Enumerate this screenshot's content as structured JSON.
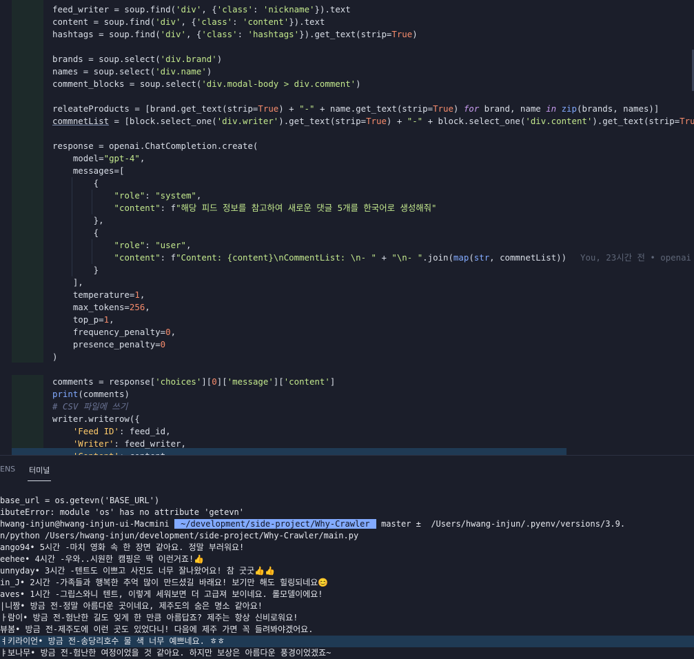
{
  "editor": {
    "blame_text": "You, 23시간 전 • openai",
    "lines": [
      {
        "t": 5,
        "text": "feed_writer = soup.find('div', {'class': 'nickname'}).text"
      },
      {
        "t": 23,
        "text": "content = soup.find('div', {'class': 'content'}).text"
      },
      {
        "t": 41,
        "text": "hashtags = soup.find('div', {'class': 'hashtags'}).get_text(strip=True)"
      },
      {
        "t": 77,
        "text": "brands = soup.select('div.brand')"
      },
      {
        "t": 95,
        "text": "names = soup.select('div.name')"
      },
      {
        "t": 113,
        "text": "comment_blocks = soup.select('div.modal-body > div.comment')"
      },
      {
        "t": 149,
        "text": "releateProducts = [brand.get_text(strip=True) + \"-\" + name.get_text(strip=True) for brand, name in zip(brands, names)]"
      },
      {
        "t": 167,
        "text": "commnetList = [block.select_one('div.writer').get_text(strip=True) + \"-\" + block.select_one('div.content').get_text(strip=True)"
      },
      {
        "t": 203,
        "text": "response = openai.ChatCompletion.create("
      },
      {
        "t": 221,
        "text": "    model=\"gpt-4\","
      },
      {
        "t": 239,
        "text": "    messages=["
      },
      {
        "t": 257,
        "text": "        {"
      },
      {
        "t": 275,
        "text": "            \"role\": \"system\","
      },
      {
        "t": 293,
        "text": "            \"content\": f\"해당 피드 정보를 참고하여 새로운 댓글 5개를 한국어로 생성해줘\""
      },
      {
        "t": 311,
        "text": "        },"
      },
      {
        "t": 329,
        "text": "        {"
      },
      {
        "t": 347,
        "text": "            \"role\": \"user\","
      },
      {
        "t": 365,
        "text": "            \"content\": f\"Content: {content}\\nCommentList: \\n- \" + \"\\n- \".join(map(str, commnetList))"
      },
      {
        "t": 383,
        "text": "        }"
      },
      {
        "t": 401,
        "text": "    ],"
      },
      {
        "t": 419,
        "text": "    temperature=1,"
      },
      {
        "t": 437,
        "text": "    max_tokens=256,"
      },
      {
        "t": 455,
        "text": "    top_p=1,"
      },
      {
        "t": 473,
        "text": "    frequency_penalty=0,"
      },
      {
        "t": 491,
        "text": "    presence_penalty=0"
      },
      {
        "t": 509,
        "text": ")"
      },
      {
        "t": 545,
        "text": "comments = response['choices'][0]['message']['content']"
      },
      {
        "t": 563,
        "text": "print(comments)"
      },
      {
        "t": 581,
        "text": "# CSV 파일에 쓰기"
      },
      {
        "t": 599,
        "text": "writer.writerow({"
      },
      {
        "t": 617,
        "text": "    'Feed ID': feed_id,"
      },
      {
        "t": 635,
        "text": "    'Writer': feed_writer,"
      },
      {
        "t": 653,
        "text": "    'Content': content,"
      }
    ]
  },
  "panel": {
    "tab_partial": "ENS",
    "tab_terminal": "터미널"
  },
  "terminal": {
    "lines": [
      "base_url = os.getevn('BASE_URL')",
      "ibuteError: module 'os' has no attribute 'getevn'",
      "__PROMPT__",
      "n/python /Users/hwang-injun/development/side-project/Why-Crawler/main.py",
      "ango94• 5시간 -마치 영화 속 한 장면 같아요. 정말 부러워요!",
      "eehee• 4시간 -우와..시원한 캠핑은 딱 이런거죠!👍",
      "unnyday• 3시간 -텐트도 이쁘고 사진도 너무 잘나왔어요! 참 굿굿👍👍",
      "in_J• 2시간 -가족들과 행복한 추억 많이 만드셨길 바래요! 보기만 해도 힐링되네요😊",
      "aves• 1시간 -그립스와니 텐트, 이렇게 세워보면 더 고급져 보이네요. 롤모델이에요!",
      "|니짱• 방금 전-정말 아름다운 곳이네요, 제주도의 숨은 명소 같아요!",
      "ㅏ람이• 방금 전-험난한 길도 잊게 한 만큼 아름답죠? 제주는 항상 신비로워요!",
      "뷰봄• 방금 전-제주도에 이런 곳도 있었다니! 다음에 제주 가면 꼭 들려봐야겠어요.",
      "ㅕ키라이언• 방금 전-송당리호수 물 색 너무 예쁘네요. ㅎㅎ",
      "ㅑ보나무• 방금 전-험난한 여정이었을 것 같아요. 하지만 보상은 아름다운 풍경이었겠죠~"
    ],
    "prompt": {
      "user": "hwang-injun@hwang-injun-ui-Macmini",
      "path": " ~/development/side-project/Why-Crawler ",
      "git": " master ± ",
      "rest": " /Users/hwang-injun/.pyenv/versions/3.9."
    }
  }
}
